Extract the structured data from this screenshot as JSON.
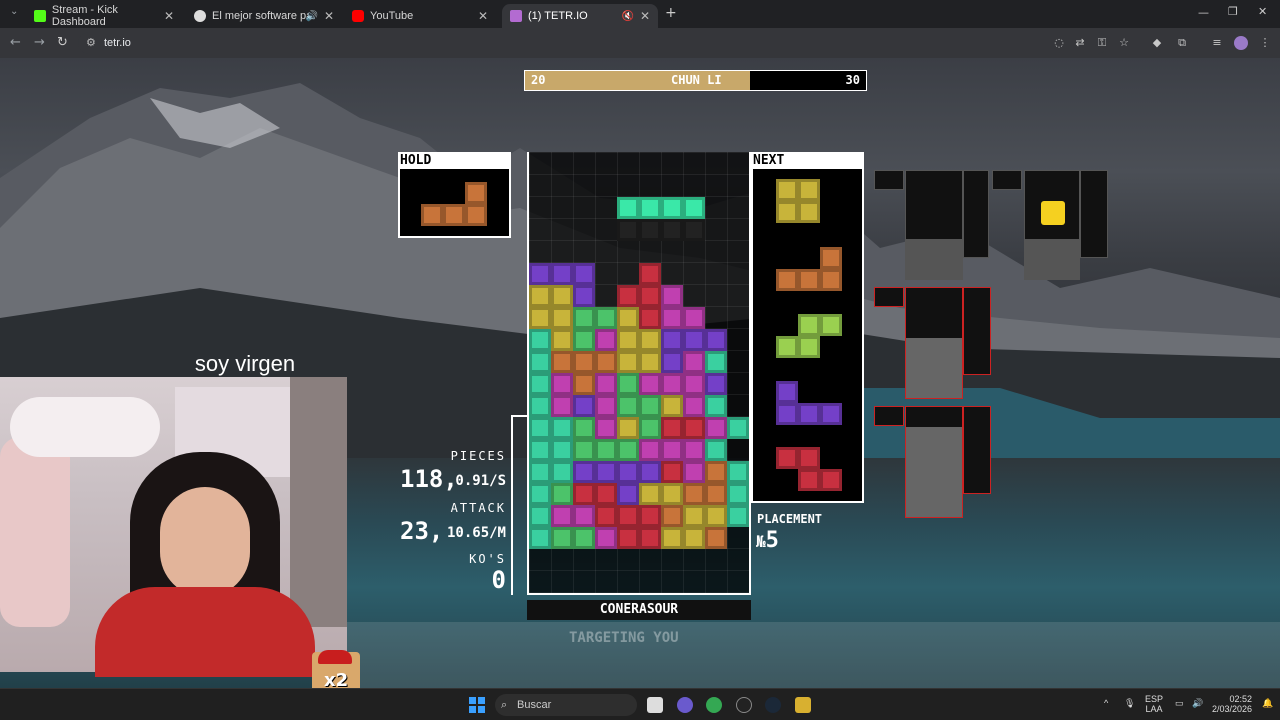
{
  "tabs": [
    {
      "title": "Stream - Kick Dashboard",
      "color": "#53fc18"
    },
    {
      "title": "El mejor software para pote",
      "color": "#ffffff"
    },
    {
      "title": "YouTube",
      "color": "#ff0000"
    },
    {
      "title": "(1) TETR.IO",
      "color": "#b36bd1"
    }
  ],
  "address": {
    "url": "tetr.io"
  },
  "game": {
    "score_left": "20",
    "opponent": "CHUN LI",
    "score_right": "30",
    "score_fill_fraction": 0.66,
    "hold_label": "HOLD",
    "next_label": "NEXT",
    "pieces_label": "PIECES",
    "pieces_value": "118,",
    "pieces_rate": "0.91/S",
    "attack_label": "ATTACK",
    "attack_value": "23,",
    "attack_rate": "10.65/M",
    "kos_label": "KO'S",
    "kos_value": "0",
    "placement_label": "PLACEMENT",
    "placement_prefix": "№",
    "placement_value": "5",
    "player_name": "CONERASOUR",
    "overlay_text": "TARGETING YOU"
  },
  "stream": {
    "caption": "soy virgen",
    "emote_text": "x2"
  },
  "taskbar": {
    "search_placeholder": "Buscar",
    "lang_top": "ESP",
    "lang_bottom": "LAA",
    "time": "02:52",
    "date": "2/03/2026"
  }
}
